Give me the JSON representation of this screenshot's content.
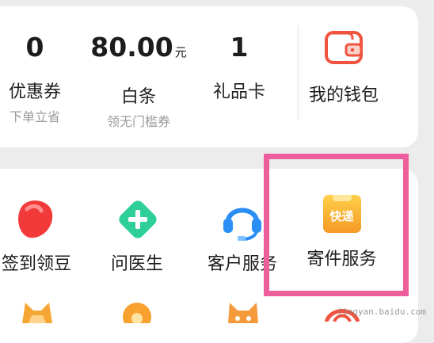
{
  "wallet": {
    "coupon": {
      "value": "0",
      "label": "优惠券",
      "sub": "下单立省"
    },
    "baitiao": {
      "value": "80.00",
      "unit": "元",
      "label": "白条",
      "sub": "领无门槛券"
    },
    "giftcard": {
      "value": "1",
      "label": "礼品卡"
    },
    "mywallet": {
      "label": "我的钱包"
    }
  },
  "services": [
    {
      "label": "签到领豆",
      "icon": "jd-bean-icon"
    },
    {
      "label": "问医生",
      "icon": "medical-cross-icon"
    },
    {
      "label": "客户服务",
      "icon": "headset-icon"
    },
    {
      "label": "寄件服务",
      "badge": "快递",
      "icon": "express-package-icon"
    }
  ],
  "watermark": "jingyan.baidu.com",
  "colors": {
    "accent": "#f0533e",
    "highlight": "#ee5e9d",
    "medical": "#2fcf9a",
    "service": "#2a8ef5",
    "express": "#f7a530"
  }
}
